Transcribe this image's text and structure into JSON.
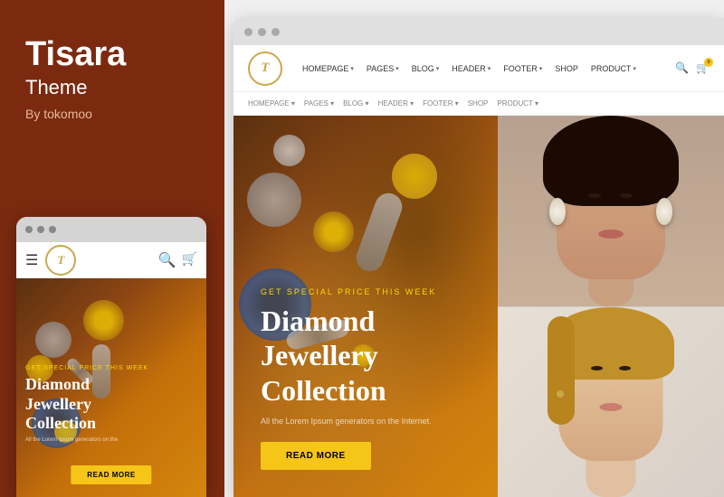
{
  "left_panel": {
    "brand_name": "Tisara",
    "brand_subtitle": "Theme",
    "by_text": "By tokomoo"
  },
  "mobile": {
    "logo_letter": "T",
    "get_special_text": "GET SPECIAL PRICE THIS WEEK",
    "hero_title_line1": "Diamond",
    "hero_title_line2": "Jewellery",
    "hero_title_line3": "Collection",
    "lorem_text": "All the Lorem Ipsum generators on the",
    "read_more_btn": "READ MORE"
  },
  "browser": {
    "nav_items": [
      {
        "label": "HOMEPAGE",
        "has_arrow": true
      },
      {
        "label": "PAGES",
        "has_arrow": true
      },
      {
        "label": "BLOG",
        "has_arrow": true
      },
      {
        "label": "HEADER",
        "has_arrow": true
      },
      {
        "label": "FOOTER",
        "has_arrow": true
      },
      {
        "label": "SHOP",
        "has_arrow": false
      },
      {
        "label": "PRODUCT",
        "has_arrow": true
      }
    ],
    "logo_letter": "T",
    "hero": {
      "get_special": "GET SPECIAL PRICE THIS WEEK",
      "title_line1": "Diamond Jewellery",
      "title_line2": "Collection",
      "lorem_text": "All the Lorem Ipsum generators on the Internet.",
      "read_more_btn": "READ More"
    }
  },
  "colors": {
    "left_bg": "#7B2A10",
    "hero_bg_start": "#5a3010",
    "hero_bg_end": "#d4860c",
    "accent_gold": "#f5c518",
    "brand_gold": "#c9a84c",
    "white": "#ffffff"
  },
  "icons": {
    "search": "🔍",
    "cart": "🛒",
    "hamburger": "☰",
    "dot": "●"
  }
}
